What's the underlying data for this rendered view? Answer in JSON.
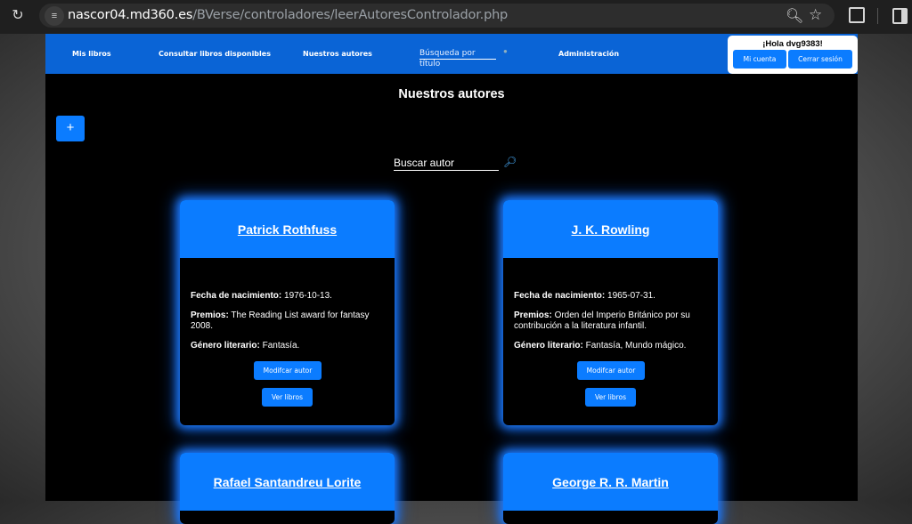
{
  "browser": {
    "url_host": "nascor04.md360.es",
    "url_path": "/BVerse/controladores/leerAutoresControlador.php",
    "icons": {
      "reload": "reload-icon",
      "site_info": "site-info-icon",
      "zoom": "zoom-icon",
      "bookmark": "star-icon",
      "extensions": "extensions-icon",
      "side_panel": "side-panel-icon"
    }
  },
  "nav": {
    "items": [
      {
        "label": "Mis libros"
      },
      {
        "label": "Consultar libros disponibles"
      },
      {
        "label": "Nuestros autores"
      },
      {
        "label": "Administración"
      }
    ],
    "search_placeholder": "Búsqueda por título",
    "search_icon": "magnifier-icon"
  },
  "user": {
    "greeting": "¡Hola dvg9383!",
    "account_label": "Mi cuenta",
    "logout_label": "Cerrar sesión"
  },
  "main": {
    "title": "Nuestros autores",
    "add_label": "+",
    "author_search_placeholder": "Buscar autor",
    "author_search_icon": "magnifier-icon"
  },
  "labels": {
    "birth": "Fecha de nacimiento:",
    "awards": "Premios:",
    "genre": "Género literario:",
    "edit": "Modifcar autor",
    "books": "Ver libros"
  },
  "authors": [
    {
      "name": "Patrick Rothfuss",
      "birth": "1976-10-13.",
      "awards": "The Reading List award for fantasy 2008.",
      "genre": "Fantasía."
    },
    {
      "name": "J. K. Rowling",
      "birth": "1965-07-31.",
      "awards": "Orden del Imperio Británico por su contribución a la literatura infantil.",
      "genre": "Fantasía, Mundo mágico."
    },
    {
      "name": "Rafael Santandreu Lorite"
    },
    {
      "name": "George R. R. Martin"
    }
  ],
  "colors": {
    "nav_blue": "#0a64d6",
    "button_blue": "#0b7cff",
    "glow": "#1e7cff",
    "page_bg": "#000000"
  }
}
